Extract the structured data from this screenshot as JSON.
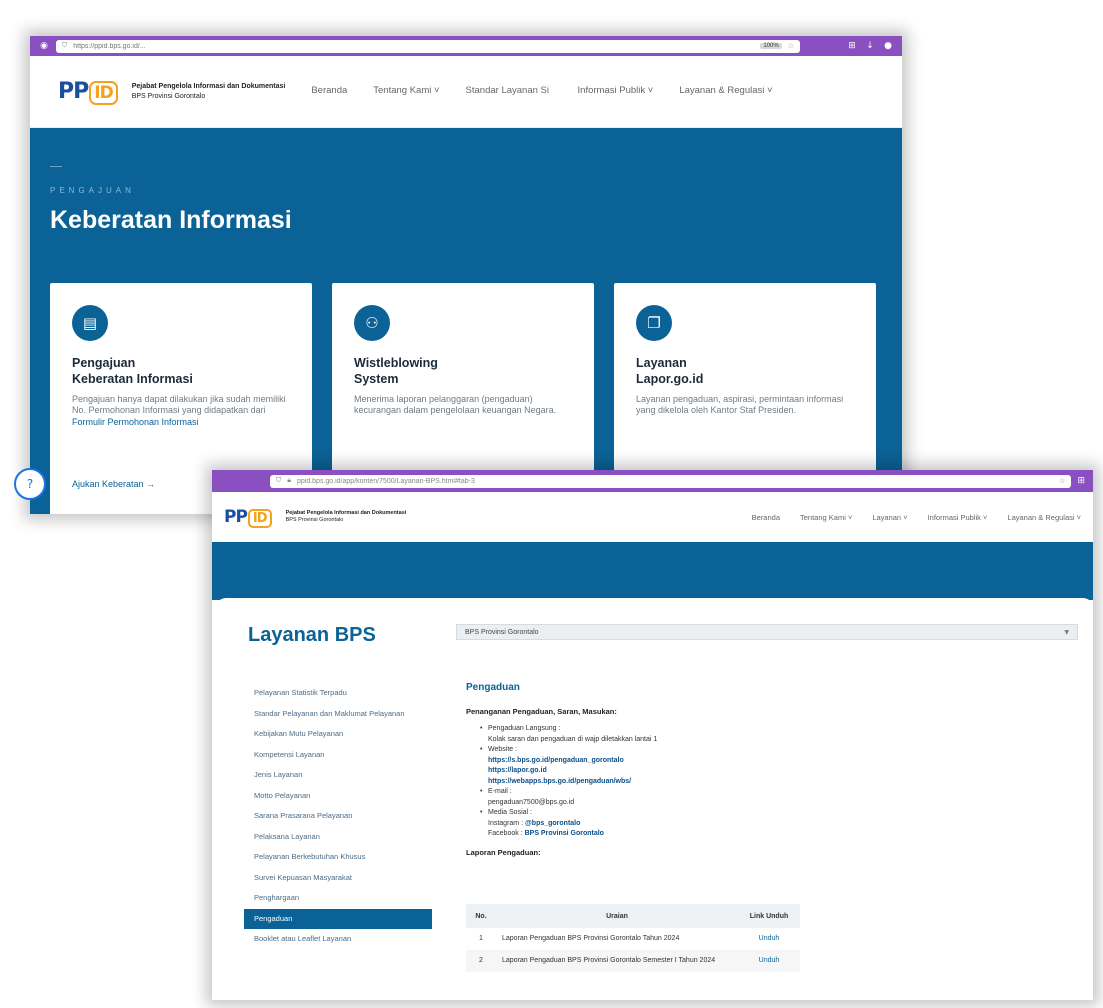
{
  "window1": {
    "url": "https://ppid.bps.go.id/...",
    "zoom": "100%",
    "brand": {
      "logo": "PPID",
      "line1": "Pejabat Pengelola Informasi dan Dokumentasi",
      "line2": "BPS Provinsi Gorontalo"
    },
    "menu": [
      "Beranda",
      "Tentang Kami ˅",
      "Standar Layanan Si",
      "Informasi Publik ˅",
      "Layanan & Regulasi ˅"
    ],
    "hero": {
      "eyebrow": "PENGAJUAN",
      "title": "Keberatan Informasi"
    },
    "cards": [
      {
        "title1": "Pengajuan",
        "title2": "Keberatan Informasi",
        "desc": "Pengajuan hanya dapat dilakukan jika sudah memiliki No. Permohonan Informasi yang didapatkan dari",
        "link": "Formulir Permohonan Informasi",
        "action": "Ajukan Keberatan →"
      },
      {
        "title1": "Wistleblowing",
        "title2": "System",
        "desc": "Menerima laporan pelanggaran (pengaduan) kecurangan dalam pengelolaan keuangan Negara."
      },
      {
        "title1": "Layanan",
        "title2": "Lapor.go.id",
        "desc": "Layanan pengaduan, aspirasi, permintaan informasi yang dikelola oleh Kantor Staf Presiden."
      }
    ]
  },
  "window2": {
    "url": "ppid.bps.go.id/app/konten/7500/Layanan-BPS.html#tab-3",
    "brand": {
      "logo": "PPID",
      "line1": "Pejabat Pengelola Informasi dan Dokumentasi",
      "line2": "BPS Provinsi Gorontalo"
    },
    "menu": [
      "Beranda",
      "Tentang Kami ˅",
      "Layanan ˅",
      "Informasi Publik ˅",
      "Layanan & Regulasi ˅"
    ],
    "page_title": "Layanan BPS",
    "select_value": "BPS Provinsi Gorontalo",
    "sidebar": [
      "Pelayanan Statistik Terpadu",
      "Standar Pelayanan dan Maklumat Pelayanan",
      "Kebijakan Mutu Pelayanan",
      "Kompetensi Layanan",
      "Jenis Layanan",
      "Motto Pelayanan",
      "Sarana Prasarana Pelayanan",
      "Pelaksana Layanan",
      "Pelayanan Berkebutuhan Khusus",
      "Survei Kepuasan Masyarakat",
      "Penghargaan",
      "Pengaduan",
      "Booklet atau Leaflet Layanan"
    ],
    "content": {
      "heading": "Pengaduan",
      "subheading": "Penanganan Pengaduan, Saran, Masukan:",
      "direct_label": "Pengaduan Langsung :",
      "direct_text": "Kolak saran dan pengaduan di wajp diletakkan lantai 1",
      "website_label": "Website :",
      "websites": [
        "https://s.bps.go.id/pengaduan_gorontalo",
        "https://lapor.go.id",
        "https://webapps.bps.go.id/pengaduan/wbs/"
      ],
      "email_label": "E-mail :",
      "email": "pengaduan7500@bps.go.id",
      "social_label": "Media Sosial :",
      "instagram_label": "Instagram :",
      "instagram": "@bps_gorontalo",
      "facebook_label": "Facebook :",
      "facebook": "BPS Provinsi Gorontalo",
      "reports_label": "Laporan Pengaduan:"
    },
    "table": {
      "headers": [
        "No.",
        "Uraian",
        "Link Unduh"
      ],
      "rows": [
        {
          "no": "1",
          "desc": "Laporan Pengaduan BPS Provinsi Gorontalo Tahun 2024",
          "link": "Unduh"
        },
        {
          "no": "2",
          "desc": "Laporan Pengaduan BPS Provinsi Gorontalo Semester I Tahun 2024",
          "link": "Unduh"
        }
      ]
    }
  }
}
